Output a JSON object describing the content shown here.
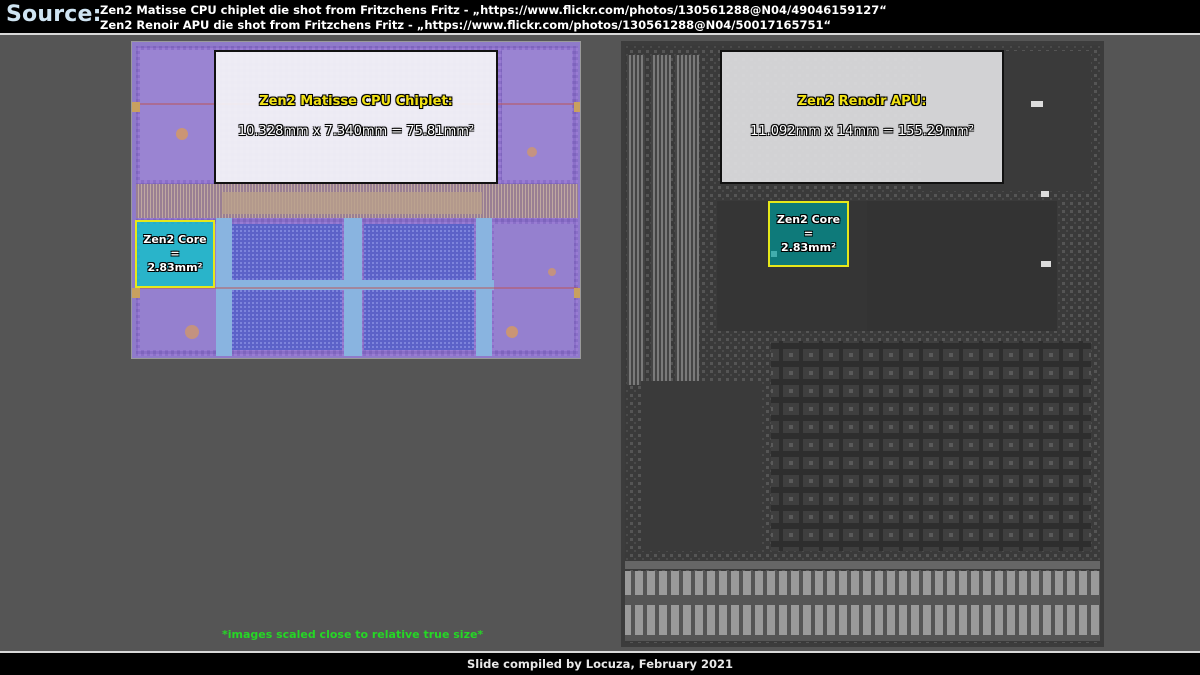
{
  "header": {
    "label": "Source:",
    "sources": [
      "Zen2 Matisse CPU chiplet die shot from Fritzchens Fritz - „https://www.flickr.com/photos/130561288@N04/49046159127“",
      "Zen2 Renoir APU die shot from Fritzchens Fritz  - „https://www.flickr.com/photos/130561288@N04/50017165751“"
    ]
  },
  "matisse": {
    "title": "Zen2 Matisse CPU Chiplet:",
    "size": "10.328mm x 7.340mm = 75.81mm²",
    "core": [
      "Zen2 Core",
      "=",
      "2.83mm²"
    ]
  },
  "renoir": {
    "title": "Zen2 Renoir APU:",
    "size": "11.092mm x 14mm = 155.29mm²",
    "core": [
      "Zen2 Core",
      "=",
      "2.83mm²"
    ]
  },
  "note": "*images scaled close to relative true size*",
  "footer": "Slide compiled by Locuza, February 2021",
  "colors": {
    "background": "#555555",
    "title_yellow": "#f2e215",
    "note_green": "#25d825",
    "core_highlight": "#00c8c8",
    "core_border": "#e6e81a"
  }
}
